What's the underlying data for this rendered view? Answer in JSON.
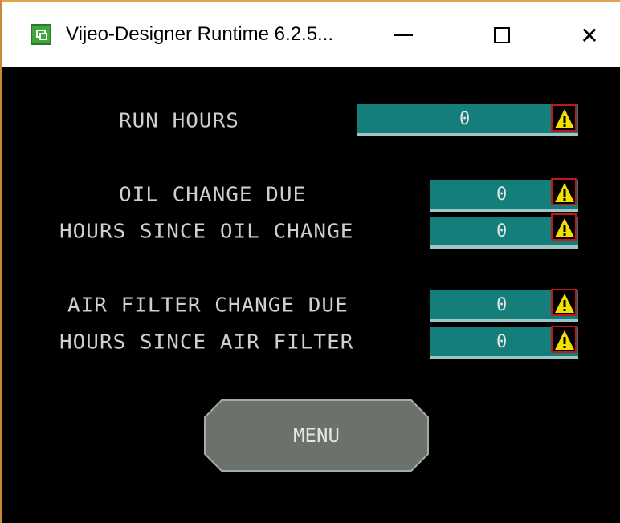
{
  "window": {
    "title": "Vijeo-Designer Runtime 6.2.5...",
    "minimize_symbol": "minimize",
    "maximize_symbol": "maximize",
    "close_symbol": "✕"
  },
  "hmi": {
    "run_hours": {
      "label": "RUN HOURS",
      "value": "0"
    },
    "oil_change_due": {
      "label": "OIL CHANGE DUE",
      "value": "0"
    },
    "hours_since_oil_change": {
      "label": "HOURS SINCE OIL CHANGE",
      "value": "0"
    },
    "air_filter_change_due": {
      "label": "AIR FILTER CHANGE DUE",
      "value": "0"
    },
    "hours_since_air_filter": {
      "label": "HOURS SINCE AIR FILTER",
      "value": "0"
    },
    "menu_label": "MENU",
    "warning_icon": "warning-triangle-icon"
  },
  "colors": {
    "field_fill": "#147e7a",
    "warning_fill": "#f2e000",
    "warning_border": "#c01818",
    "button_fill": "#6b716b"
  }
}
